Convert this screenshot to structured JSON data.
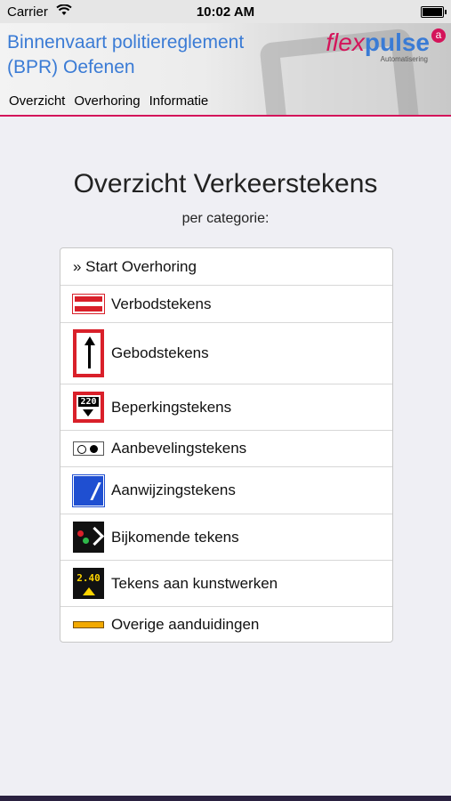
{
  "statusbar": {
    "carrier": "Carrier",
    "time": "10:02 AM"
  },
  "header": {
    "title_line1": "Binnenvaart politiereglement",
    "title_line2": "(BPR) Oefenen",
    "logo_flex": "flex",
    "logo_pulse": "pulse",
    "logo_badge": "a",
    "logo_sub": "Automatisering",
    "nav": [
      "Overzicht",
      "Overhoring",
      "Informatie"
    ]
  },
  "main": {
    "title": "Overzicht Verkeerstekens",
    "subtitle": "per categorie:",
    "start": "» Start Overhoring",
    "items": [
      {
        "label": "Verbodstekens",
        "icon": "prohibition-sign-icon"
      },
      {
        "label": "Gebodstekens",
        "icon": "mandatory-sign-icon"
      },
      {
        "label": "Beperkingstekens",
        "icon": "restriction-sign-icon",
        "sign_text": "220"
      },
      {
        "label": "Aanbevelingstekens",
        "icon": "recommendation-sign-icon"
      },
      {
        "label": "Aanwijzingstekens",
        "icon": "indication-sign-icon"
      },
      {
        "label": "Bijkomende tekens",
        "icon": "additional-sign-icon"
      },
      {
        "label": "Tekens aan kunstwerken",
        "icon": "structure-sign-icon",
        "sign_text": "2.40"
      },
      {
        "label": "Overige aanduidingen",
        "icon": "other-sign-icon"
      }
    ]
  },
  "colors": {
    "accent": "#3a7bd5",
    "brand_pink": "#d4145a",
    "sign_red": "#d9202a",
    "sign_blue": "#1f4fd1",
    "sign_yellow": "#ffd400"
  }
}
